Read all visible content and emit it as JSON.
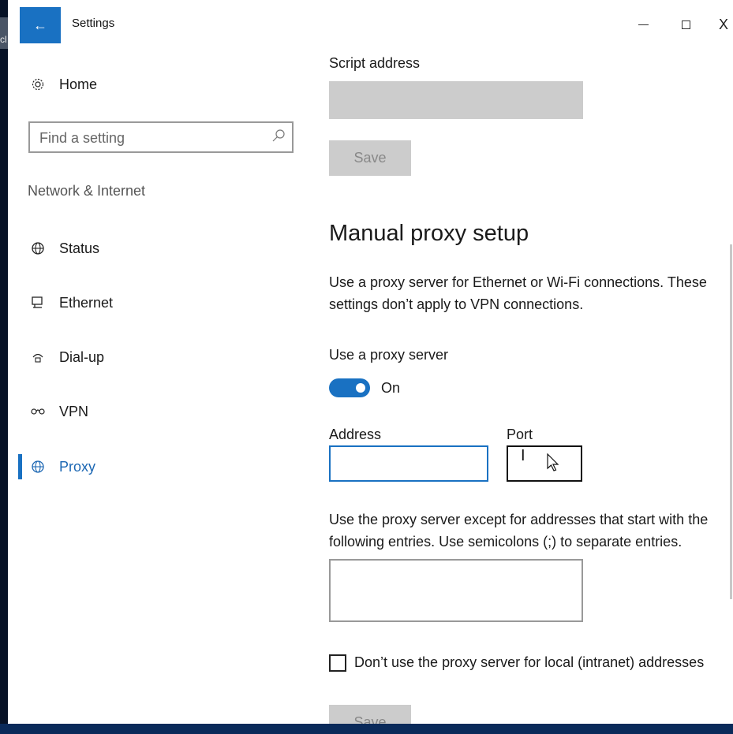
{
  "window": {
    "title": "Settings",
    "back_glyph": "←",
    "close_glyph": "X"
  },
  "desktop": {
    "fragment_text": "cl"
  },
  "sidebar": {
    "home_label": "Home",
    "search_placeholder": "Find a setting",
    "section_label": "Network & Internet",
    "items": [
      {
        "label": "Status",
        "icon": "globe-icon"
      },
      {
        "label": "Ethernet",
        "icon": "ethernet-icon"
      },
      {
        "label": "Dial-up",
        "icon": "dialup-icon"
      },
      {
        "label": "VPN",
        "icon": "vpn-icon"
      },
      {
        "label": "Proxy",
        "icon": "globe-icon",
        "selected": true
      }
    ]
  },
  "main": {
    "script_address_label": "Script address",
    "script_save_label": "Save",
    "manual_heading": "Manual proxy setup",
    "manual_description": "Use a proxy server for Ethernet or Wi-Fi connections. These settings don’t apply to VPN connections.",
    "use_proxy_label": "Use a proxy server",
    "toggle_state": "On",
    "address_label": "Address",
    "address_value": "",
    "port_label": "Port",
    "port_value": "",
    "exceptions_description": "Use the proxy server except for addresses that start with the following entries. Use semicolons (;) to separate entries.",
    "exceptions_value": "",
    "local_bypass_label": "Don’t use the proxy server for local (intranet) addresses",
    "local_bypass_checked": false,
    "bottom_save_label": "Save"
  },
  "colors": {
    "accent": "#1971c2",
    "selected_text": "#1c67b3",
    "disabled_fill": "#cccccc"
  }
}
